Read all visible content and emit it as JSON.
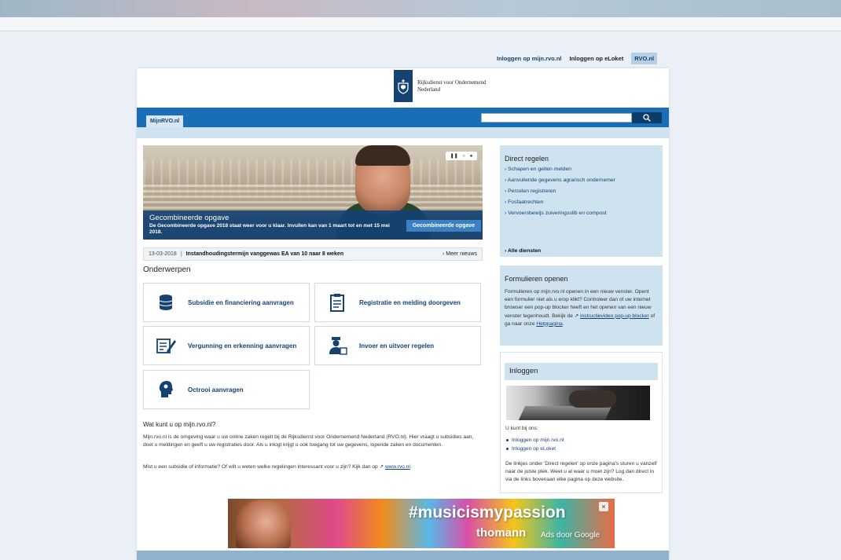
{
  "toplinks": {
    "mijn": "Inloggen op mijn.rvo.nl",
    "eloket": "Inloggen op eLoket",
    "rvo": "RVO.nl"
  },
  "logo": {
    "line1": "Rijksdienst voor Ondernemend",
    "line2": "Nederland"
  },
  "nav": {
    "tab": "MijnRVO.nl",
    "search_placeholder": ""
  },
  "hero": {
    "title": "Gecombineerde opgave",
    "text": "De Gecombineerde opgave 2018 staat weer voor u klaar. Invullen kan van 1 maart tot en met 15 mei 2018.",
    "button": "Gecombineerde opgave"
  },
  "ticker": {
    "date": "13-03-2018",
    "sep": "|",
    "text": "Instandhoudingstermijn vanggewas EA van 10 naar 8 weken",
    "more": "› Meer nieuws"
  },
  "onderwerpen": {
    "title": "Onderwerpen",
    "tiles": [
      {
        "label": "Subsidie en financiering aanvragen",
        "icon": "coins-icon"
      },
      {
        "label": "Registratie en melding doorgeven",
        "icon": "clipboard-icon"
      },
      {
        "label": "Vergunning en erkenning aanvragen",
        "icon": "document-pen-icon"
      },
      {
        "label": "Invoer en uitvoer regelen",
        "icon": "customs-officer-icon"
      },
      {
        "label": "Octrooi aanvragen",
        "icon": "head-idea-icon"
      }
    ]
  },
  "about": {
    "title": "Wat kunt u op mijn.rvo.nl?",
    "p1": "Mijn.rvo.nl is de omgeving waar u uw online zaken regelt bij de Rijksdienst voor Ondernemend Nederland (RVO.nl). Hier vraagt u subsidies aan, doet u meldingen en geeft u uw registraties door. Als u inlogt krijgt u ook toegang tot uw gegevens, lopende zaken en documenten.",
    "p2_text": "Mist u een subsidie of informatie? Of wilt u weten welke regelingen interessant voor u zijn? Kijk dan op",
    "p2_link": "www.rvo.nl",
    "p2_end": "."
  },
  "direct": {
    "title": "Direct regelen",
    "items": [
      "› Schapen en geiten melden",
      "› Aanvullende gegevens agrarisch ondernemer",
      "› Percelen registreren",
      "› Fosfaatrechten",
      "› Vervoersbewijs zuiveringsslib en compost"
    ],
    "all": "› Alle diensten"
  },
  "formulieren": {
    "title": "Formulieren openen",
    "text": "Formulieren op mijn.rvo.nl openen in een nieuw venster. Opent een formulier niet als u erop klikt? Controleer dan of uw internet browser een pop-up blocker heeft en het openen van een nieuw venster tegenhoudt. Bekijk de",
    "link1": "instructievideo pop-up blocker",
    "mid": "of ga naar onze",
    "link2": "Helppagina",
    "end": "."
  },
  "login": {
    "title": "Inloggen",
    "intro": "U kunt bij ons:",
    "links": [
      "Inloggen op mijn.rvo.nl",
      "Inloggen op eLoket"
    ],
    "text": "De linkjes onder 'Direct regelen' op onze pagina's sturen u vanzelf naar de juiste plek. Weet u al waar u moet zijn? Log dan direct in via de links bovenaan elke pagina op deze website."
  },
  "ad": {
    "tag": "#musicismypassion",
    "brand": "thomann",
    "ads": "Ads door Google",
    "close": "×"
  },
  "colors": {
    "brand": "#154273",
    "nav": "#1a6eb5",
    "panel": "#cfe2f0"
  }
}
